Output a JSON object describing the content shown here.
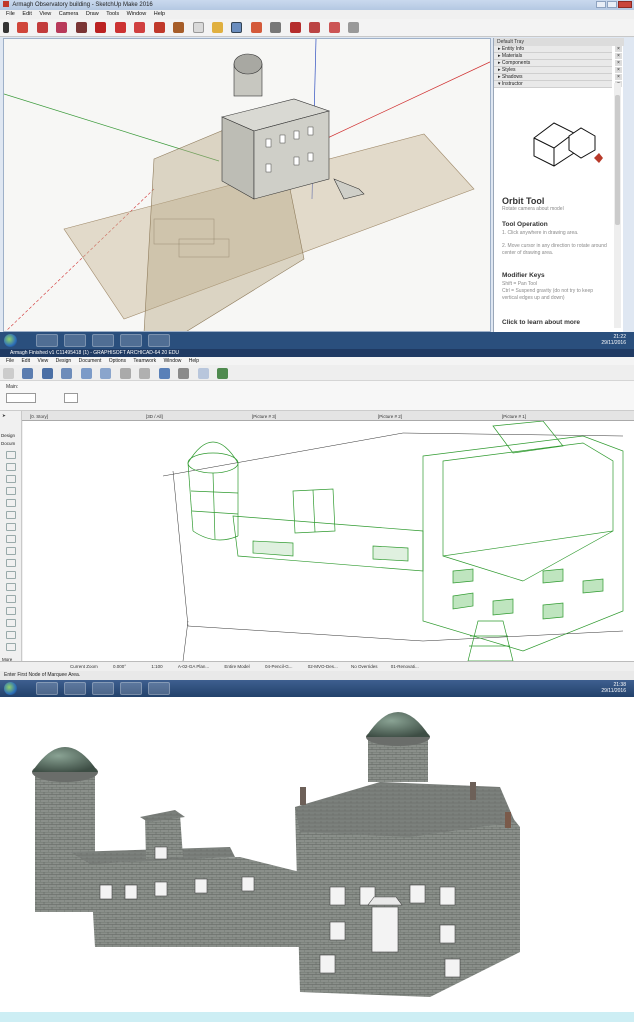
{
  "sketchup": {
    "title": "Armagh Observatory building - SketchUp Make 2016",
    "menu": [
      "File",
      "Edit",
      "View",
      "Camera",
      "Draw",
      "Tools",
      "Window",
      "Help"
    ],
    "tray": {
      "header": "Default Tray",
      "items": [
        "Entity Info",
        "Materials",
        "Components",
        "Styles",
        "Shadows",
        "Instructor"
      ],
      "instructor": {
        "tool_name": "Orbit Tool",
        "tool_desc": "Rotate camera about model",
        "operation_title": "Tool Operation",
        "steps": [
          "1.  Click anywhere in drawing area.",
          "2.  Move cursor in any direction to rotate around center of drawing area."
        ],
        "modifier_title": "Modifier Keys",
        "modifiers": [
          "Shift = Pan Tool",
          "Ctrl = Suspend gravity (do not try to keep vertical edges up and down)"
        ],
        "learn_more": "Click to learn about more"
      }
    },
    "taskbar": {
      "time": "21:22",
      "date": "29/11/2016"
    }
  },
  "archicad": {
    "title": "Armagh Finished v1 C11495418 (1) - GRAPHISOFT ARCHICAD-64 20 EDU",
    "menu": [
      "File",
      "Edit",
      "View",
      "Design",
      "Document",
      "Options",
      "Teamwork",
      "Window",
      "Help"
    ],
    "info_label": "Main:",
    "tabs": [
      "[0. Story]",
      "[3D / All]",
      "[Picture # 3]",
      "[Picture # 2]",
      "[Picture # 1]"
    ],
    "toolbox": {
      "design": "Design",
      "document": "Docum",
      "more": "More"
    },
    "nav": [
      "Current Zoom",
      "0.000°",
      "1:100",
      "A-02-GA Plan...",
      "Entire Model",
      "04-Pencil-G...",
      "02-MVO-Des...",
      "No Overrides",
      "01-Renovati..."
    ],
    "status": "Enter First Node of Marquee Area.",
    "taskbar": {
      "time": "21:38",
      "date": "29/11/2016"
    }
  },
  "render": {
    "description": "rendered"
  }
}
